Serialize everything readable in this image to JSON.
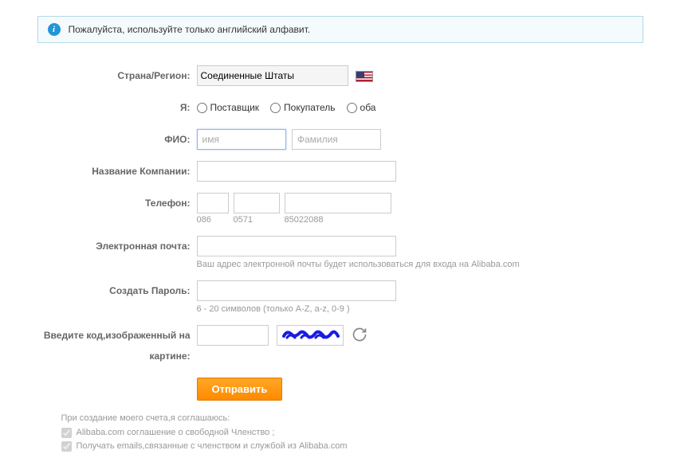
{
  "banner": {
    "text": "Пожалуйста, используйте только английский алфавит."
  },
  "labels": {
    "country": "Страна/Регион:",
    "iam": "Я:",
    "fullname": "ФИО:",
    "company": "Название Компании:",
    "phone": "Телефон:",
    "email": "Электронная почта:",
    "password": "Создать Пароль:",
    "captcha": "Введите код,изображенный на картине:"
  },
  "country": {
    "selected": "Соединенные Штаты"
  },
  "iam_options": {
    "supplier": "Поставщик",
    "buyer": "Покупатель",
    "both": "оба"
  },
  "name": {
    "first_placeholder": "имя",
    "last_placeholder": "Фамилия"
  },
  "phone_hints": {
    "cc": "086",
    "ac": "0571",
    "num": "85022088"
  },
  "email_hint": "Ваш адрес электронной почты будет использоваться для входа на Alibaba.com",
  "password_hint": "6 - 20 символов (только A-Z, a-z, 0-9 )",
  "submit": "Отправить",
  "agree": {
    "intro": "При создание моего счета,я соглашаюсь:",
    "line1": "Alibaba.com соглашение о свободной Членство ;",
    "line2": "Получать emails,связанные с членством и службой из Alibaba.com"
  }
}
